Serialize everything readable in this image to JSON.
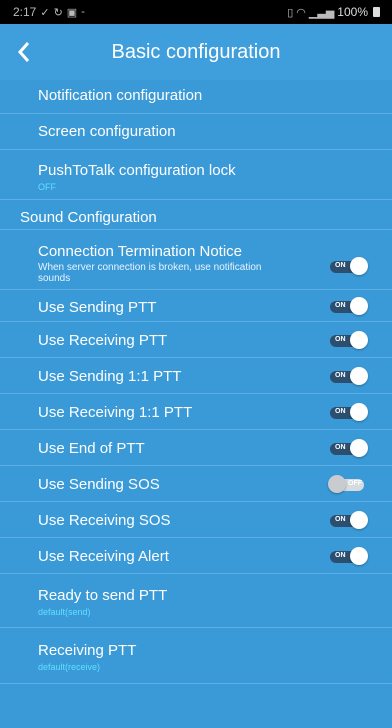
{
  "status_bar": {
    "time": "2:17",
    "icons_left": [
      "check-icon",
      "sync-icon",
      "image-icon",
      "dash"
    ],
    "icons_right": [
      "vibrate-icon",
      "wifi-icon",
      "signal-icon"
    ],
    "battery": "100%"
  },
  "header": {
    "title": "Basic configuration"
  },
  "settings": [
    {
      "label": "Notification configuration"
    },
    {
      "label": "Screen configuration"
    },
    {
      "label": "PushToTalk configuration lock",
      "value": "OFF"
    }
  ],
  "sound_section": {
    "title": "Sound Configuration"
  },
  "sound_items": [
    {
      "label": "Connection Termination Notice",
      "description": "When server connection is broken, use notification sounds",
      "state": "ON"
    },
    {
      "label": "Use Sending PTT",
      "state": "ON"
    },
    {
      "label": "Use Receiving PTT",
      "state": "ON"
    },
    {
      "label": "Use Sending 1:1 PTT",
      "state": "ON"
    },
    {
      "label": "Use Receiving 1:1 PTT",
      "state": "ON"
    },
    {
      "label": "Use End of PTT",
      "state": "ON"
    },
    {
      "label": "Use Sending SOS",
      "state": "OFF"
    },
    {
      "label": "Use Receiving SOS",
      "state": "ON"
    },
    {
      "label": "Use Receiving Alert",
      "state": "ON"
    }
  ],
  "sound_choices": [
    {
      "label": "Ready to send PTT",
      "value": "default(send)"
    },
    {
      "label": "Receiving PTT",
      "value": "default(receive)"
    }
  ],
  "colors": {
    "background": "#3a9ad8",
    "header": "#3f9fdc",
    "value_text": "#5fe0ff"
  }
}
